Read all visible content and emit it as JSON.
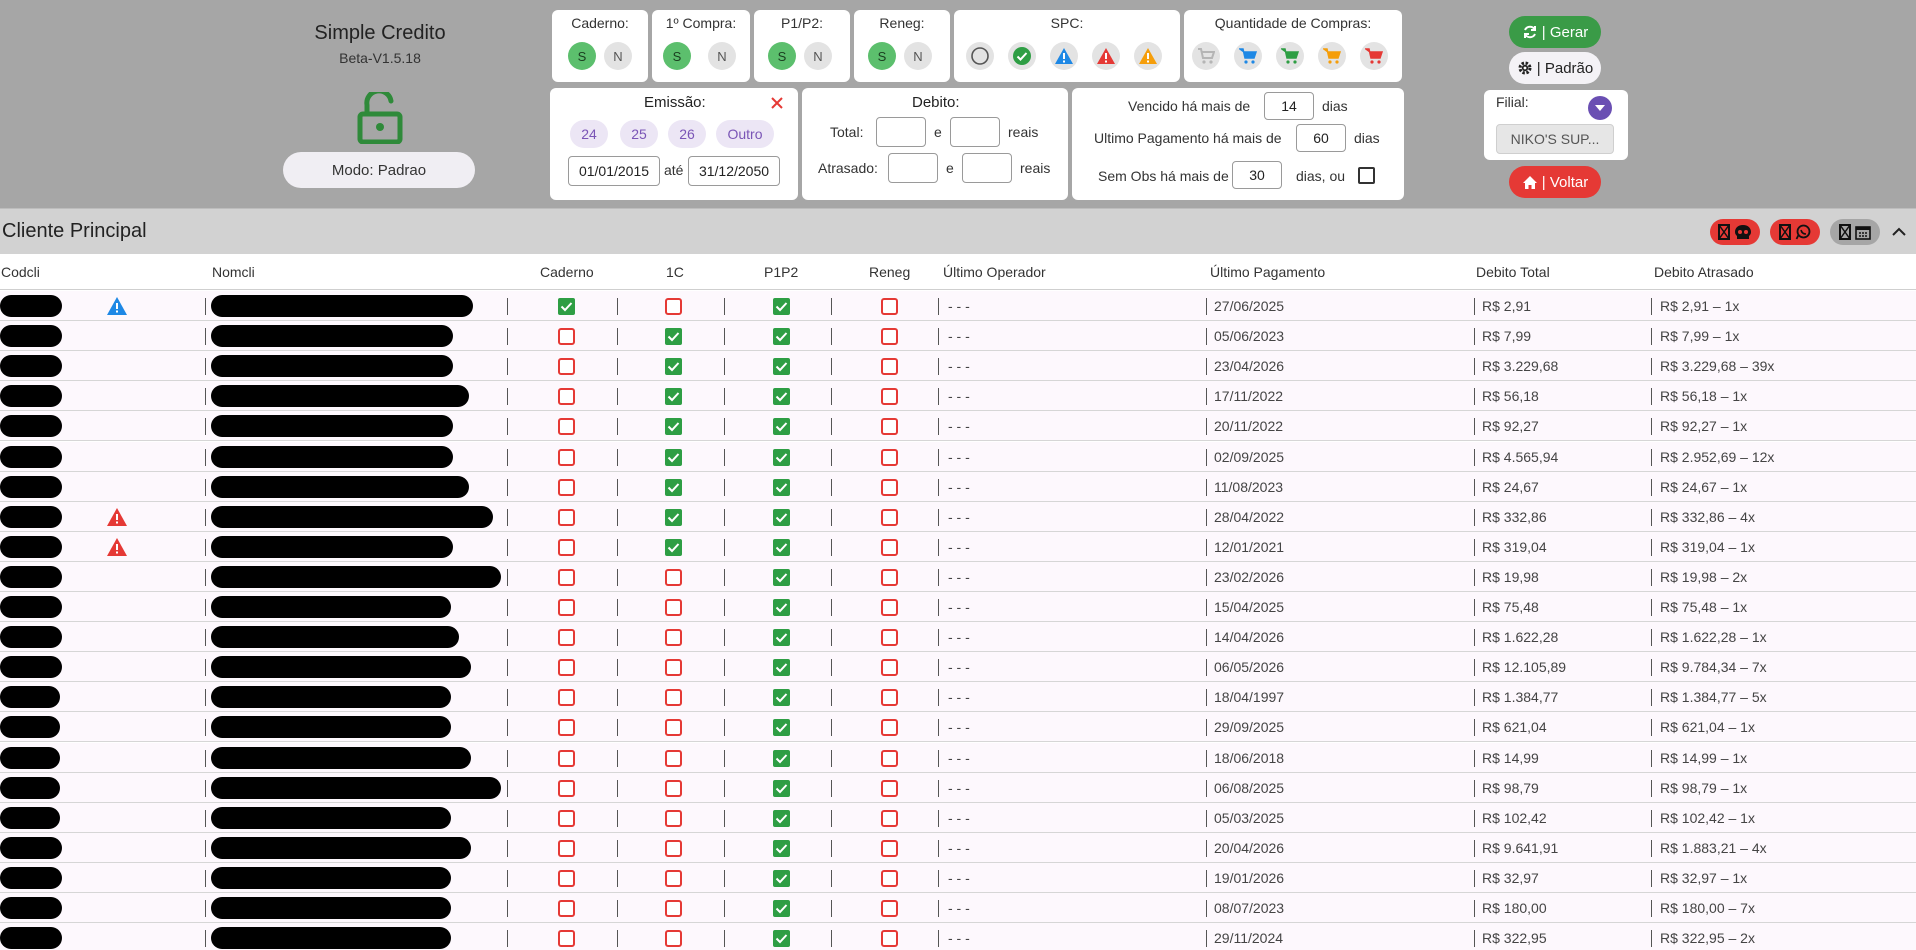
{
  "app": {
    "title": "Simple Credito",
    "version": "Beta-V1.5.18",
    "mode_label": "Modo: Padrao"
  },
  "filters": {
    "caderno": {
      "label": "Caderno:",
      "s": "S",
      "n": "N"
    },
    "primeira_compra": {
      "label": "1º Compra:",
      "s": "S",
      "n": "N"
    },
    "p1p2": {
      "label": "P1/P2:",
      "s": "S",
      "n": "N"
    },
    "reneg": {
      "label": "Reneg:",
      "s": "S",
      "n": "N"
    },
    "spc": {
      "label": "SPC:",
      "icons": [
        "empty-circle-icon",
        "check-circle-icon",
        "blue-warning-icon",
        "red-warning-icon",
        "orange-warning-icon"
      ]
    },
    "quantidade": {
      "label": "Quantidade de Compras:",
      "icons": [
        "cart-grey-icon",
        "cart-blue-icon",
        "cart-green-icon",
        "cart-orange-icon",
        "cart-red-icon"
      ]
    },
    "emissao": {
      "label": "Emissão:",
      "year_options": [
        "24",
        "25",
        "26",
        "Outro"
      ],
      "from": "01/01/2015",
      "until_label": "até",
      "to": "31/12/2050"
    },
    "debito": {
      "label": "Debito:",
      "total_label": "Total:",
      "atrasado_label": "Atrasado:",
      "and_label": "e",
      "unit": "reais",
      "total_min": "",
      "total_max": "",
      "atrasado_min": "",
      "atrasado_max": ""
    },
    "vencido": {
      "prefix": "Vencido há mais de",
      "value": "14",
      "suffix": "dias"
    },
    "ultimo_pagamento": {
      "prefix": "Ultimo Pagamento há mais de",
      "value": "60",
      "suffix": "dias"
    },
    "sem_obs": {
      "prefix": "Sem Obs há mais de",
      "value": "30",
      "suffix": "dias, ou"
    }
  },
  "actions": {
    "gerar": "| Gerar",
    "padrao": "| Padrão",
    "voltar": "| Voltar",
    "filial_label": "Filial:",
    "filial_value": "NIKO'S SUP..."
  },
  "section": {
    "title": "Cliente Principal"
  },
  "colors": {
    "accent_green": "#3a9b47",
    "red": "#e53935",
    "blue": "#1e88e5",
    "purple": "#6a4fb3"
  },
  "table": {
    "headers": [
      "Codcli",
      "Nomcli",
      "Caderno",
      "1C",
      "P1P2",
      "Reneg",
      "Último Operador",
      "Último Pagamento",
      "Debito Total",
      "Debito Atrasado"
    ],
    "rows": [
      {
        "alert": "blue",
        "caderno": true,
        "c1": false,
        "p1p2": true,
        "reneg": false,
        "operador": "- - -",
        "pagamento": "27/06/2025",
        "total": "R$ 2,91",
        "atrasado": "R$ 2,91 – 1x"
      },
      {
        "alert": "",
        "caderno": false,
        "c1": true,
        "p1p2": true,
        "reneg": false,
        "operador": "- - -",
        "pagamento": "05/06/2023",
        "total": "R$ 7,99",
        "atrasado": "R$ 7,99 – 1x"
      },
      {
        "alert": "",
        "caderno": false,
        "c1": true,
        "p1p2": true,
        "reneg": false,
        "operador": "- - -",
        "pagamento": "23/04/2026",
        "total": "R$ 3.229,68",
        "atrasado": "R$ 3.229,68 – 39x"
      },
      {
        "alert": "",
        "caderno": false,
        "c1": true,
        "p1p2": true,
        "reneg": false,
        "operador": "- - -",
        "pagamento": "17/11/2022",
        "total": "R$ 56,18",
        "atrasado": "R$ 56,18 – 1x"
      },
      {
        "alert": "",
        "caderno": false,
        "c1": true,
        "p1p2": true,
        "reneg": false,
        "operador": "- - -",
        "pagamento": "20/11/2022",
        "total": "R$ 92,27",
        "atrasado": "R$ 92,27 – 1x"
      },
      {
        "alert": "",
        "caderno": false,
        "c1": true,
        "p1p2": true,
        "reneg": false,
        "operador": "- - -",
        "pagamento": "02/09/2025",
        "total": "R$ 4.565,94",
        "atrasado": "R$ 2.952,69 – 12x"
      },
      {
        "alert": "",
        "caderno": false,
        "c1": true,
        "p1p2": true,
        "reneg": false,
        "operador": "- - -",
        "pagamento": "11/08/2023",
        "total": "R$ 24,67",
        "atrasado": "R$ 24,67 – 1x"
      },
      {
        "alert": "red",
        "caderno": false,
        "c1": true,
        "p1p2": true,
        "reneg": false,
        "operador": "- - -",
        "pagamento": "28/04/2022",
        "total": "R$ 332,86",
        "atrasado": "R$ 332,86 – 4x"
      },
      {
        "alert": "red",
        "caderno": false,
        "c1": true,
        "p1p2": true,
        "reneg": false,
        "operador": "- - -",
        "pagamento": "12/01/2021",
        "total": "R$ 319,04",
        "atrasado": "R$ 319,04 – 1x"
      },
      {
        "alert": "",
        "caderno": false,
        "c1": false,
        "p1p2": true,
        "reneg": false,
        "operador": "- - -",
        "pagamento": "23/02/2026",
        "total": "R$ 19,98",
        "atrasado": "R$ 19,98 – 2x"
      },
      {
        "alert": "",
        "caderno": false,
        "c1": false,
        "p1p2": true,
        "reneg": false,
        "operador": "- - -",
        "pagamento": "15/04/2025",
        "total": "R$ 75,48",
        "atrasado": "R$ 75,48 – 1x"
      },
      {
        "alert": "",
        "caderno": false,
        "c1": false,
        "p1p2": true,
        "reneg": false,
        "operador": "- - -",
        "pagamento": "14/04/2026",
        "total": "R$ 1.622,28",
        "atrasado": "R$ 1.622,28 – 1x"
      },
      {
        "alert": "",
        "caderno": false,
        "c1": false,
        "p1p2": true,
        "reneg": false,
        "operador": "- - -",
        "pagamento": "06/05/2026",
        "total": "R$ 12.105,89",
        "atrasado": "R$ 9.784,34 – 7x"
      },
      {
        "alert": "",
        "caderno": false,
        "c1": false,
        "p1p2": true,
        "reneg": false,
        "operador": "- - -",
        "pagamento": "18/04/1997",
        "total": "R$ 1.384,77",
        "atrasado": "R$ 1.384,77 – 5x"
      },
      {
        "alert": "",
        "caderno": false,
        "c1": false,
        "p1p2": true,
        "reneg": false,
        "operador": "- - -",
        "pagamento": "29/09/2025",
        "total": "R$ 621,04",
        "atrasado": "R$ 621,04 – 1x"
      },
      {
        "alert": "",
        "caderno": false,
        "c1": false,
        "p1p2": true,
        "reneg": false,
        "operador": "- - -",
        "pagamento": "18/06/2018",
        "total": "R$ 14,99",
        "atrasado": "R$ 14,99 – 1x"
      },
      {
        "alert": "",
        "caderno": false,
        "c1": false,
        "p1p2": true,
        "reneg": false,
        "operador": "- - -",
        "pagamento": "06/08/2025",
        "total": "R$ 98,79",
        "atrasado": "R$ 98,79 – 1x"
      },
      {
        "alert": "",
        "caderno": false,
        "c1": false,
        "p1p2": true,
        "reneg": false,
        "operador": "- - -",
        "pagamento": "05/03/2025",
        "total": "R$ 102,42",
        "atrasado": "R$ 102,42 – 1x"
      },
      {
        "alert": "",
        "caderno": false,
        "c1": false,
        "p1p2": true,
        "reneg": false,
        "operador": "- - -",
        "pagamento": "20/04/2026",
        "total": "R$ 9.641,91",
        "atrasado": "R$ 1.883,21 – 4x"
      },
      {
        "alert": "",
        "caderno": false,
        "c1": false,
        "p1p2": true,
        "reneg": false,
        "operador": "- - -",
        "pagamento": "19/01/2026",
        "total": "R$ 32,97",
        "atrasado": "R$ 32,97 – 1x"
      },
      {
        "alert": "",
        "caderno": false,
        "c1": false,
        "p1p2": true,
        "reneg": false,
        "operador": "- - -",
        "pagamento": "08/07/2023",
        "total": "R$ 180,00",
        "atrasado": "R$ 180,00 – 7x"
      },
      {
        "alert": "",
        "caderno": false,
        "c1": false,
        "p1p2": true,
        "reneg": false,
        "operador": "- - -",
        "pagamento": "29/11/2024",
        "total": "R$ 322,95",
        "atrasado": "R$ 322,95 – 2x"
      }
    ]
  }
}
